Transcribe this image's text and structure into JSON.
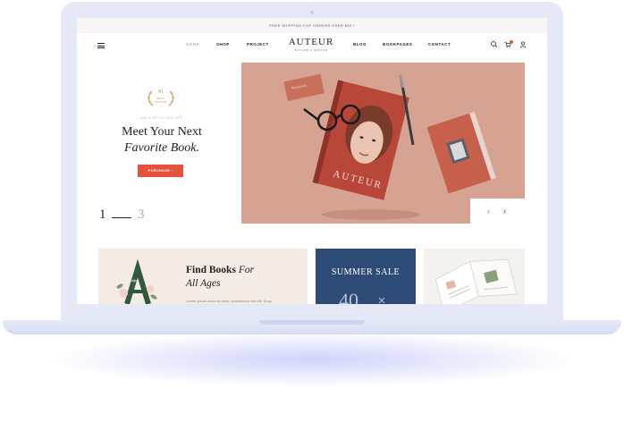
{
  "colors": {
    "accent": "#e4533d",
    "gold": "#b8893c",
    "laptop_frame": "#e4e8f7",
    "hero_bg": "#d6a393",
    "sale_card": "#2e4b78",
    "find_card": "#f4ebe4"
  },
  "announcement": "FREE SHIPPING FOR ORDERS OVER $50 !",
  "nav": {
    "menu_icon": "hamburger-icon",
    "items_left": [
      "HOME",
      "SHOP",
      "PROJECT"
    ],
    "logo": "AUTEUR",
    "logo_sub": "AUTHOR & WRITER",
    "items_right": [
      "BLOG",
      "BOOKPAGES",
      "CONTACT"
    ],
    "icons": [
      "search-icon",
      "cart-icon",
      "user-icon"
    ]
  },
  "hero": {
    "badge_number": "#1",
    "badge_label_1": "BEST",
    "badge_label_2": "SELLER",
    "subtitle": "SALE UP TO 30% OFF",
    "title_line1": "Meet Your Next",
    "title_line2": "Favorite Book.",
    "cta_label": "PURCHASE",
    "slide_current": "1",
    "slide_total": "3",
    "book_title": "AUTEUR",
    "card_text": "Restaurant",
    "prev_label": "‹",
    "next_label": "›"
  },
  "cards": {
    "find_title": "Find Books",
    "find_title_italic": "For",
    "find_title_line2": "All Ages",
    "find_text": "Lorem ipsum dolor sit amet, consectetur nisi elit. Susp",
    "sale_title": "SUMMER SALE",
    "sale_number": "40"
  }
}
